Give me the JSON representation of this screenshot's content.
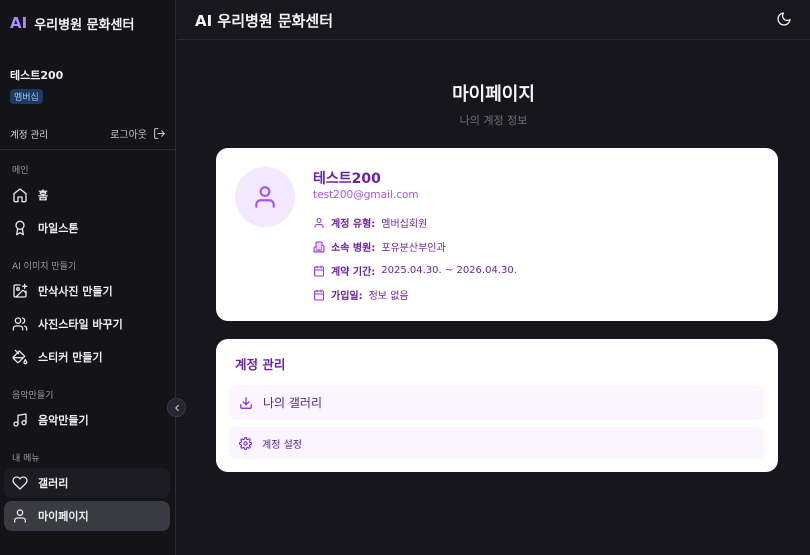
{
  "sidebar": {
    "brand_ai": "AI",
    "brand_name": "우리병원 문화센터",
    "user_name": "테스트200",
    "membership_badge": "멤버십",
    "account_label": "계정 관리",
    "logout_label": "로그아웃",
    "sections": [
      {
        "label": "메인",
        "items": [
          {
            "label": "홈",
            "icon": "home-icon"
          },
          {
            "label": "마일스톤",
            "icon": "award-icon"
          }
        ]
      },
      {
        "label": "AI 이미지 만들기",
        "items": [
          {
            "label": "만삭사진 만들기",
            "icon": "image-plus-icon"
          },
          {
            "label": "사진스타일 바꾸기",
            "icon": "users-icon"
          },
          {
            "label": "스티커 만들기",
            "icon": "paint-bucket-icon"
          }
        ]
      },
      {
        "label": "음악만들기",
        "items": [
          {
            "label": "음악만들기",
            "icon": "music-icon"
          }
        ]
      },
      {
        "label": "내 메뉴",
        "items": [
          {
            "label": "갤러리",
            "icon": "heart-icon"
          },
          {
            "label": "마이페이지",
            "icon": "user-icon",
            "active": true
          }
        ]
      }
    ]
  },
  "header": {
    "title": "AI 우리병원 문화센터",
    "theme_icon": "moon-icon"
  },
  "main": {
    "page_title": "마이페이지",
    "page_subtitle": "나의 계정 정보",
    "profile": {
      "name": "테스트200",
      "email": "test200@gmail.com",
      "rows": [
        {
          "key": "계정 유형:",
          "value": "멤버십회원",
          "icon": "user-icon"
        },
        {
          "key": "소속 병원:",
          "value": "포유분산부인과",
          "icon": "building-icon"
        },
        {
          "key": "계약 기간:",
          "value": "2025.04.30. ~ 2026.04.30.",
          "icon": "calendar-icon"
        },
        {
          "key": "가입일:",
          "value": "정보 없음",
          "icon": "calendar-icon"
        }
      ]
    },
    "manage": {
      "title": "계정 관리",
      "gallery_label": "나의 갤러리",
      "settings_label": "계정 설정"
    }
  },
  "colors": {
    "accent": "#a78bfa",
    "purple_dark": "#6b21a8",
    "purple_mid": "#a855f7",
    "avatar_bg": "#f3e8ff"
  }
}
